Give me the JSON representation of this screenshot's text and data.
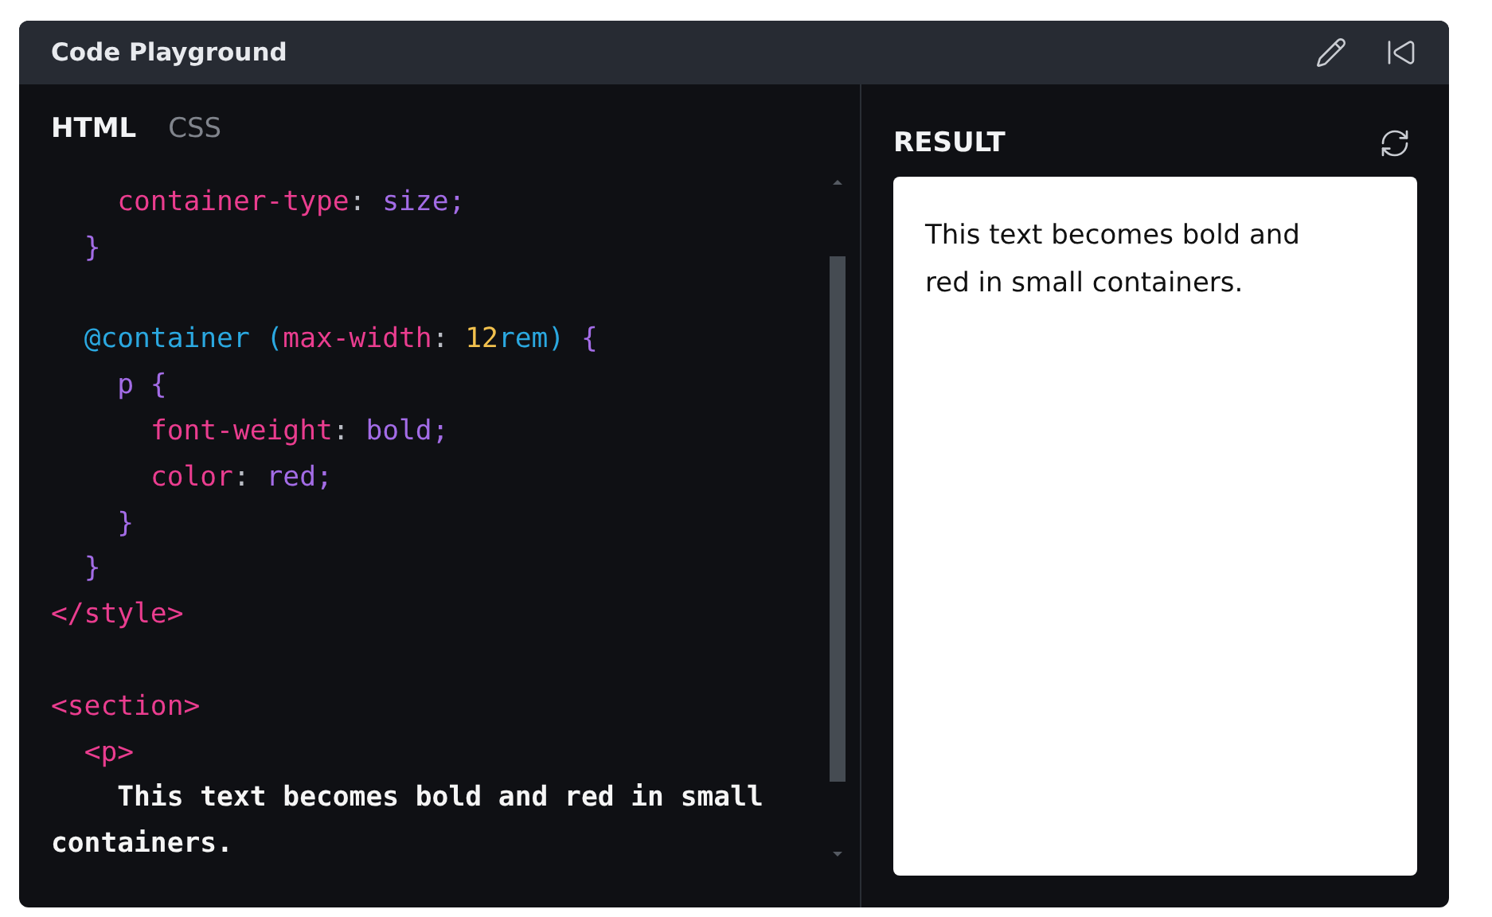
{
  "window": {
    "title": "Code Playground"
  },
  "toolbar": {
    "buttons": [
      {
        "kind": "edit"
      },
      {
        "kind": "collapse"
      }
    ]
  },
  "editor": {
    "tabs": [
      {
        "label": "HTML",
        "selected": true
      },
      {
        "label": "CSS",
        "selected": false
      }
    ],
    "lines": [
      {
        "kind": "code",
        "tokens": [
          {
            "kind": "property",
            "text": "    container-type"
          },
          {
            "kind": "punct",
            "text": ": "
          },
          {
            "kind": "value",
            "text": "size;"
          }
        ]
      },
      {
        "kind": "code",
        "tokens": [
          {
            "kind": "brace",
            "text": "  }"
          }
        ]
      },
      {
        "kind": "blank"
      },
      {
        "kind": "code",
        "tokens": [
          {
            "kind": "at",
            "text": "  @container"
          },
          {
            "kind": "paren",
            "text": " ("
          },
          {
            "kind": "property",
            "text": "max-width"
          },
          {
            "kind": "punct",
            "text": ": "
          },
          {
            "kind": "number",
            "text": "12"
          },
          {
            "kind": "paren",
            "text": "rem)"
          },
          {
            "kind": "brace",
            "text": " {"
          }
        ]
      },
      {
        "kind": "code",
        "tokens": [
          {
            "kind": "value",
            "text": "    p"
          },
          {
            "kind": "brace",
            "text": " {"
          }
        ]
      },
      {
        "kind": "code",
        "tokens": [
          {
            "kind": "property",
            "text": "      font-weight"
          },
          {
            "kind": "punct",
            "text": ": "
          },
          {
            "kind": "value",
            "text": "bold;"
          }
        ]
      },
      {
        "kind": "code",
        "tokens": [
          {
            "kind": "property",
            "text": "      color"
          },
          {
            "kind": "punct",
            "text": ": "
          },
          {
            "kind": "value",
            "text": "red;"
          }
        ]
      },
      {
        "kind": "code",
        "tokens": [
          {
            "kind": "brace",
            "text": "    }"
          }
        ]
      },
      {
        "kind": "code",
        "tokens": [
          {
            "kind": "brace",
            "text": "  }"
          }
        ]
      },
      {
        "kind": "code",
        "tokens": [
          {
            "kind": "tag",
            "text": "</style>"
          }
        ]
      },
      {
        "kind": "blank"
      },
      {
        "kind": "code",
        "tokens": [
          {
            "kind": "tag",
            "text": "<section>"
          }
        ]
      },
      {
        "kind": "code",
        "tokens": [
          {
            "kind": "tag",
            "text": "  <p>"
          }
        ]
      },
      {
        "kind": "code",
        "tokens": [
          {
            "kind": "text",
            "text": "    This text becomes bold and red in small containers."
          }
        ]
      }
    ]
  },
  "result": {
    "title": "RESULT",
    "text": "This text becomes bold and red in small containers."
  }
}
